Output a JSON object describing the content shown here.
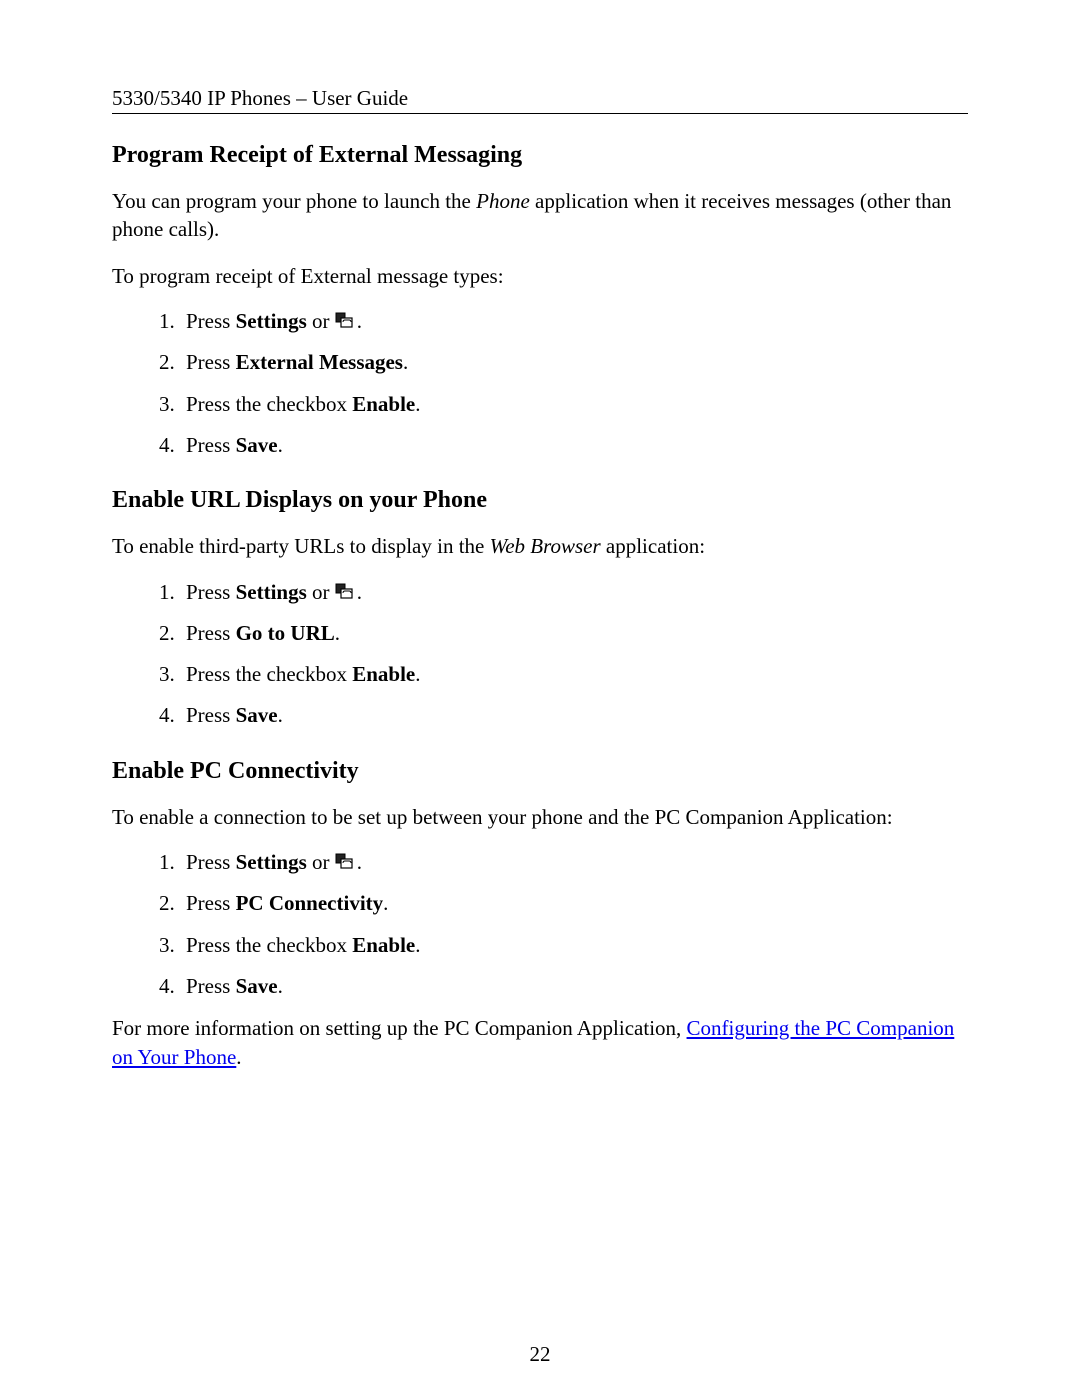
{
  "header": "5330/5340 IP Phones – User Guide",
  "page_number": "22",
  "sections": {
    "s1": {
      "title": "Program Receipt of External Messaging",
      "intro_a": "You can program your phone to launch the ",
      "intro_italic": "Phone",
      "intro_b": " application when it receives messages (other than phone calls).",
      "intro2": "To program receipt of External message types:",
      "steps": {
        "i1a": "Press ",
        "i1b": "Settings",
        "i1c": " or ",
        "i2a": "Press ",
        "i2b": "External Messages",
        "i2c": ".",
        "i3a": "Press the checkbox ",
        "i3b": "Enable",
        "i3c": ".",
        "i4a": "Press ",
        "i4b": "Save",
        "i4c": "."
      }
    },
    "s2": {
      "title": "Enable URL Displays on your Phone",
      "intro_a": "To enable third-party URLs to display in the ",
      "intro_italic": "Web Browser",
      "intro_b": " application:",
      "steps": {
        "i1a": "Press ",
        "i1b": "Settings",
        "i1c": " or ",
        "i2a": "Press ",
        "i2b": "Go to URL",
        "i2c": ".",
        "i3a": "Press the checkbox ",
        "i3b": "Enable",
        "i3c": ".",
        "i4a": "Press ",
        "i4b": "Save",
        "i4c": "."
      }
    },
    "s3": {
      "title": "Enable PC Connectivity",
      "intro": "To enable a connection to be set up between your phone and the PC Companion Application:",
      "steps": {
        "i1a": "Press ",
        "i1b": "Settings",
        "i1c": " or ",
        "i2a": "Press ",
        "i2b": "PC Connectivity",
        "i2c": ".",
        "i3a": "Press the checkbox ",
        "i3b": "Enable",
        "i3c": ".",
        "i4a": "Press ",
        "i4b": "Save",
        "i4c": "."
      },
      "outro_a": "For more information on setting up the PC Companion Application, ",
      "outro_link": "Configuring the PC Companion on Your Phone",
      "outro_b": "."
    }
  }
}
